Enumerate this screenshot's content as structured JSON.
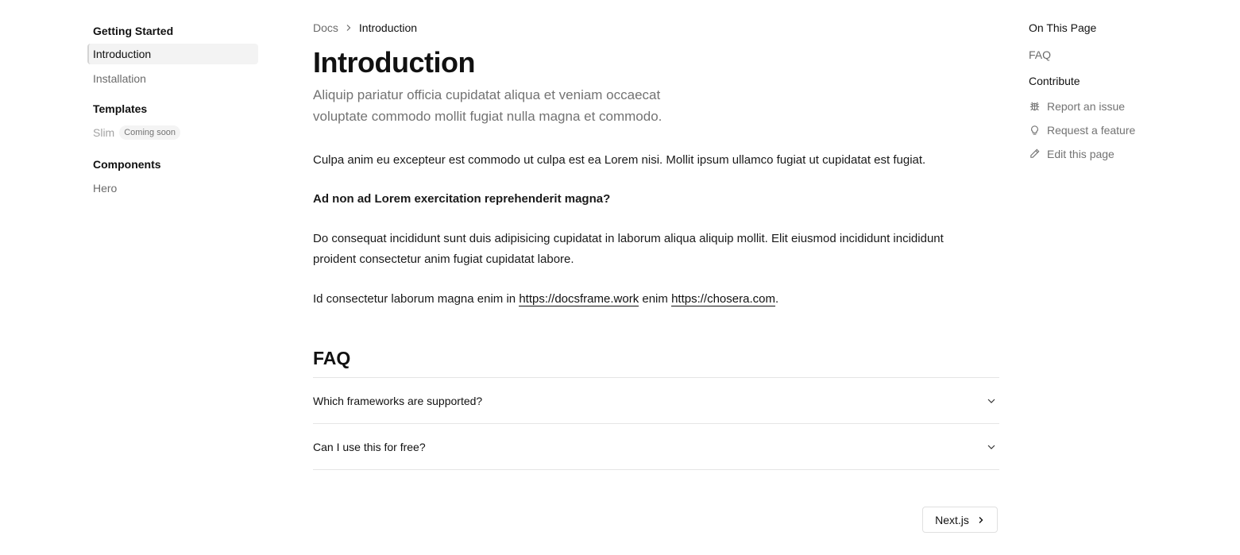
{
  "sidebar": {
    "sections": [
      {
        "title": "Getting Started",
        "items": [
          {
            "label": "Introduction"
          },
          {
            "label": "Installation"
          }
        ]
      },
      {
        "title": "Templates",
        "items": [
          {
            "label": "Slim",
            "badge": "Coming soon"
          }
        ]
      },
      {
        "title": "Components",
        "items": [
          {
            "label": "Hero"
          }
        ]
      }
    ]
  },
  "breadcrumb": {
    "root": "Docs",
    "current": "Introduction"
  },
  "page": {
    "title": "Introduction",
    "lead": "Aliquip pariatur officia cupidatat aliqua et veniam occaecat voluptate commodo mollit fugiat nulla magna et commodo.",
    "p1": "Culpa anim eu excepteur est commodo ut culpa est ea Lorem nisi. Mollit ipsum ullamco fugiat ut cupidatat est fugiat.",
    "heading": "Ad non ad Lorem exercitation reprehenderit magna?",
    "p2": "Do consequat incididunt sunt duis adipisicing cupidatat in laborum aliqua aliquip mollit. Elit eiusmod incididunt incididunt proident consectetur anim fugiat cupidatat labore.",
    "p3_prefix": "Id consectetur laborum magna enim in ",
    "link1": "https://docsframe.work",
    "p3_mid": " enim ",
    "link2": "https://chosera.com",
    "p3_suffix": "."
  },
  "faq": {
    "title": "FAQ",
    "items": [
      {
        "question": "Which frameworks are supported?"
      },
      {
        "question": "Can I use this for free?"
      }
    ]
  },
  "pagination": {
    "next_label": "Next.js"
  },
  "toc": {
    "title": "On This Page",
    "links": [
      "FAQ"
    ],
    "contribute_title": "Contribute",
    "actions": [
      {
        "label": "Report an issue",
        "icon": "bug-icon"
      },
      {
        "label": "Request a feature",
        "icon": "lightbulb-icon"
      },
      {
        "label": "Edit this page",
        "icon": "pencil-icon"
      }
    ]
  }
}
